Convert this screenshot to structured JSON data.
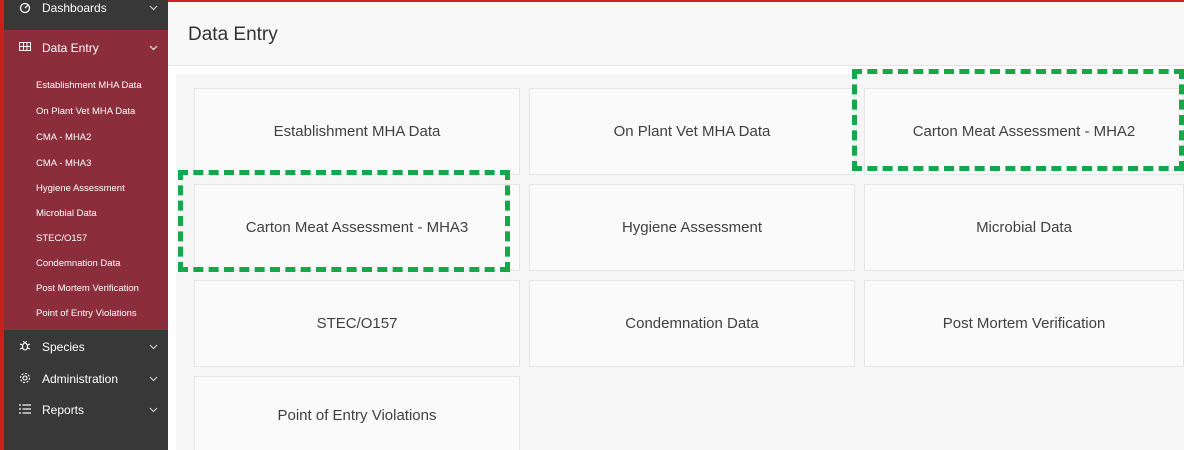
{
  "sidebar": {
    "dashboards_label": "Dashboards",
    "data_entry_label": "Data Entry",
    "submenu": [
      "Establishment MHA Data",
      "On Plant Vet MHA Data",
      "CMA - MHA2",
      "CMA - MHA3",
      "Hygiene Assessment",
      "Microbial Data",
      "STEC/O157",
      "Condemnation Data",
      "Post Mortem Verification",
      "Point of Entry Violations"
    ],
    "species_label": "Species",
    "administration_label": "Administration",
    "reports_label": "Reports"
  },
  "page": {
    "title": "Data Entry"
  },
  "cards": [
    "Establishment MHA Data",
    "On Plant Vet MHA Data",
    "Carton Meat Assessment - MHA2",
    "Carton Meat Assessment - MHA3",
    "Hygiene Assessment",
    "Microbial Data",
    "STEC/O157",
    "Condemnation Data",
    "Post Mortem Verification",
    "Point of Entry Violations"
  ],
  "colors": {
    "sidebar_bg": "#383838",
    "accent_red": "#c8201e",
    "submenu_bg": "#8c2d3b",
    "highlight_green": "#15a84b"
  },
  "icons": {
    "dashboards": "dashboard-icon",
    "data_entry": "table-icon",
    "species": "bug-icon",
    "administration": "gear-icon",
    "reports": "list-icon"
  }
}
